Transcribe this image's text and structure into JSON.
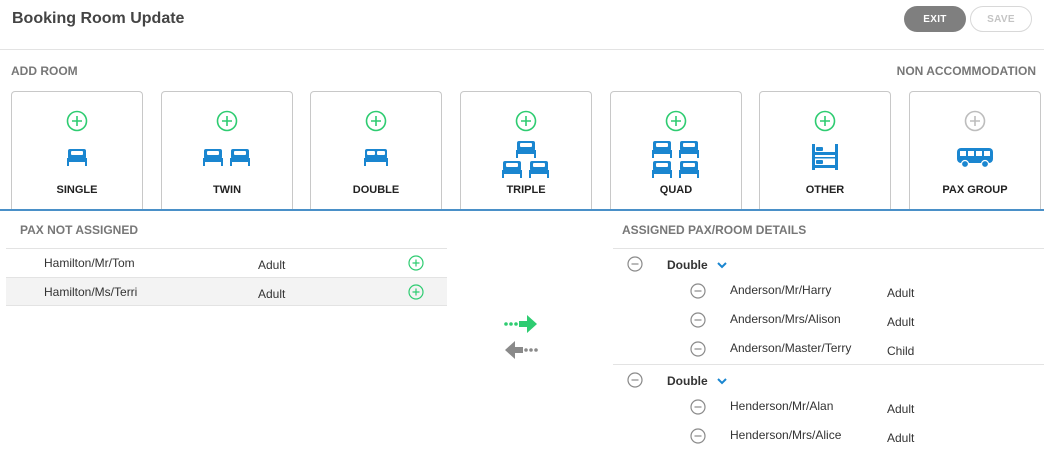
{
  "header": {
    "title": "Booking Room Update",
    "exit_label": "EXIT",
    "save_label": "SAVE"
  },
  "add_room": {
    "section_label": "ADD ROOM",
    "non_accommodation_label": "NON ACCOMMODATION",
    "room_types": [
      {
        "label": "SINGLE",
        "icon": "single-bed-icon",
        "enabled": true
      },
      {
        "label": "TWIN",
        "icon": "twin-bed-icon",
        "enabled": true
      },
      {
        "label": "DOUBLE",
        "icon": "double-bed-icon",
        "enabled": true
      },
      {
        "label": "TRIPLE",
        "icon": "triple-bed-icon",
        "enabled": true
      },
      {
        "label": "QUAD",
        "icon": "quad-bed-icon",
        "enabled": true
      },
      {
        "label": "OTHER",
        "icon": "bunk-bed-icon",
        "enabled": true
      },
      {
        "label": "PAX GROUP",
        "icon": "bus-icon",
        "enabled": false
      }
    ]
  },
  "pax_not_assigned": {
    "label": "PAX NOT ASSIGNED",
    "rows": [
      {
        "name": "Hamilton/Mr/Tom",
        "type": "Adult"
      },
      {
        "name": "Hamilton/Ms/Terri",
        "type": "Adult"
      }
    ]
  },
  "assigned": {
    "label": "ASSIGNED PAX/ROOM DETAILS",
    "rooms": [
      {
        "room_type": "Double",
        "occupants": [
          {
            "name": "Anderson/Mr/Harry",
            "type": "Adult"
          },
          {
            "name": "Anderson/Mrs/Alison",
            "type": "Adult"
          },
          {
            "name": "Anderson/Master/Terry",
            "type": "Child"
          }
        ]
      },
      {
        "room_type": "Double",
        "occupants": [
          {
            "name": "Henderson/Mr/Alan",
            "type": "Adult"
          },
          {
            "name": "Henderson/Mrs/Alice",
            "type": "Adult"
          }
        ]
      }
    ]
  },
  "colors": {
    "accent_green": "#2ecc71",
    "accent_blue": "#1a86d0",
    "divider_blue": "#4a90c8",
    "muted_gray": "#8a8a8a"
  }
}
